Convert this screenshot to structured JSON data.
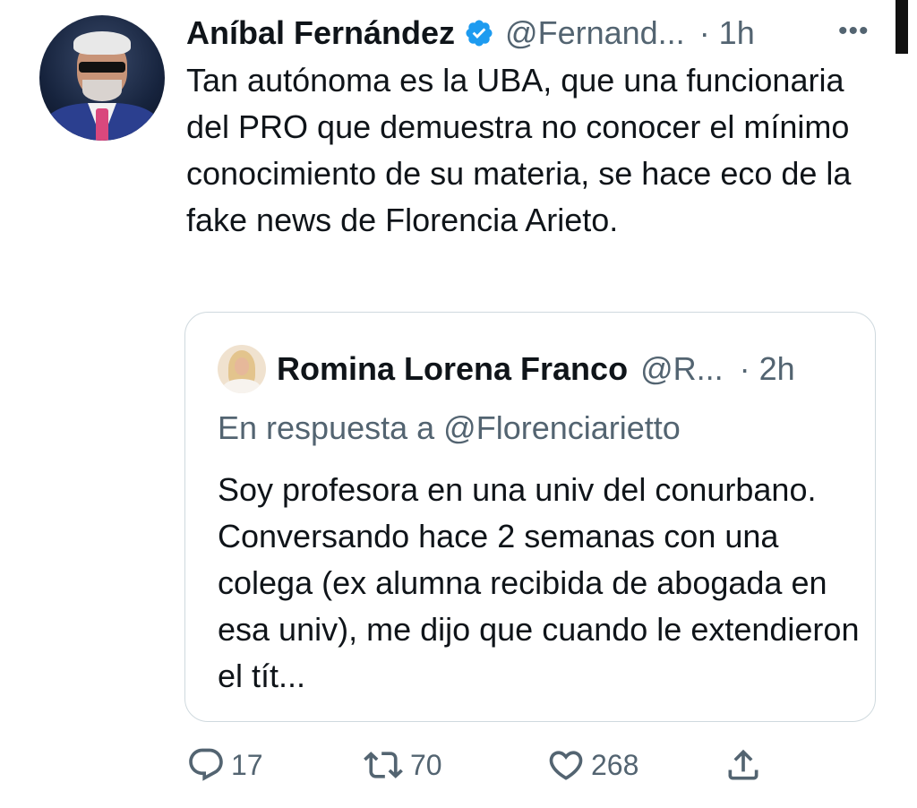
{
  "tweet": {
    "author_name": "Aníbal Fernández",
    "handle": "@Fernand...",
    "time": "· 1h",
    "more_label": "•••",
    "text": "Tan autónoma es la UBA, que una funcionaria del PRO que demuestra no conocer el mínimo conocimiento de su materia, se hace eco de la fake news de Florencia Arieto."
  },
  "quoted": {
    "author_name": "Romina Lorena Franco",
    "handle": "@R...",
    "time": "· 2h",
    "reply_to": "En respuesta a @Florenciarietto",
    "text": "Soy profesora en una univ del conurbano. Conversando hace 2 semanas con una colega (ex alumna recibida de abogada en esa univ), me dijo que cuando le extendieron el tít..."
  },
  "actions": {
    "replies": "17",
    "retweets": "70",
    "likes": "268"
  },
  "icons": {
    "verified": "verified-badge-icon",
    "reply": "reply-icon",
    "retweet": "retweet-icon",
    "like": "heart-icon",
    "share": "share-icon",
    "more": "more-icon"
  },
  "colors": {
    "accent": "#1d9bf0",
    "text": "#0f1419",
    "secondary": "#536471",
    "border": "#cfd9de"
  }
}
